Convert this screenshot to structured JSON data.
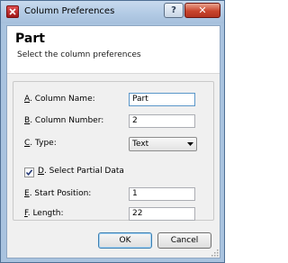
{
  "window": {
    "title": "Column Preferences",
    "help_label": "?",
    "close_label": "✕"
  },
  "header": {
    "heading": "Part",
    "subtitle": "Select the column preferences"
  },
  "fields": {
    "column_name": {
      "mnemonic": "A",
      "label": ". Column Name:",
      "value": "Part"
    },
    "column_number": {
      "mnemonic": "B",
      "label": ". Column Number:",
      "value": "2"
    },
    "type": {
      "mnemonic": "C",
      "label": ". Type:",
      "value": "Text"
    },
    "partial_data": {
      "mnemonic": "D",
      "label": ". Select Partial Data",
      "checked": true
    },
    "start_position": {
      "mnemonic": "E",
      "label": ". Start Position:",
      "value": "1"
    },
    "length": {
      "mnemonic": "F",
      "label": ". Length:",
      "value": "22"
    }
  },
  "buttons": {
    "ok": "OK",
    "cancel": "Cancel"
  }
}
